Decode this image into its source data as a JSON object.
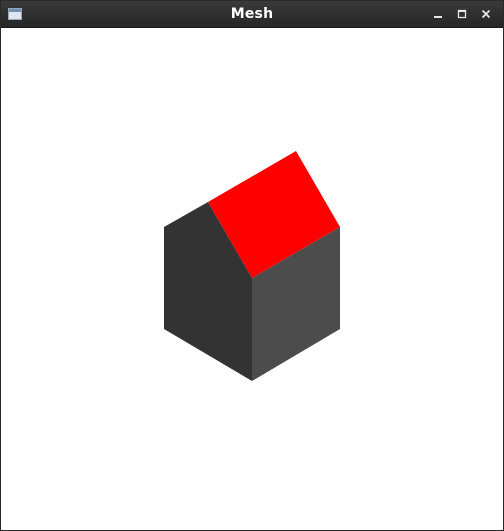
{
  "window": {
    "title": "Mesh",
    "controls": [
      "minimize",
      "maximize",
      "close"
    ]
  },
  "scene": {
    "object": "house",
    "colors": {
      "roof": "#ff0000",
      "left_wall": "#333333",
      "right_wall": "#4c4c4c",
      "background": "#ffffff"
    }
  }
}
